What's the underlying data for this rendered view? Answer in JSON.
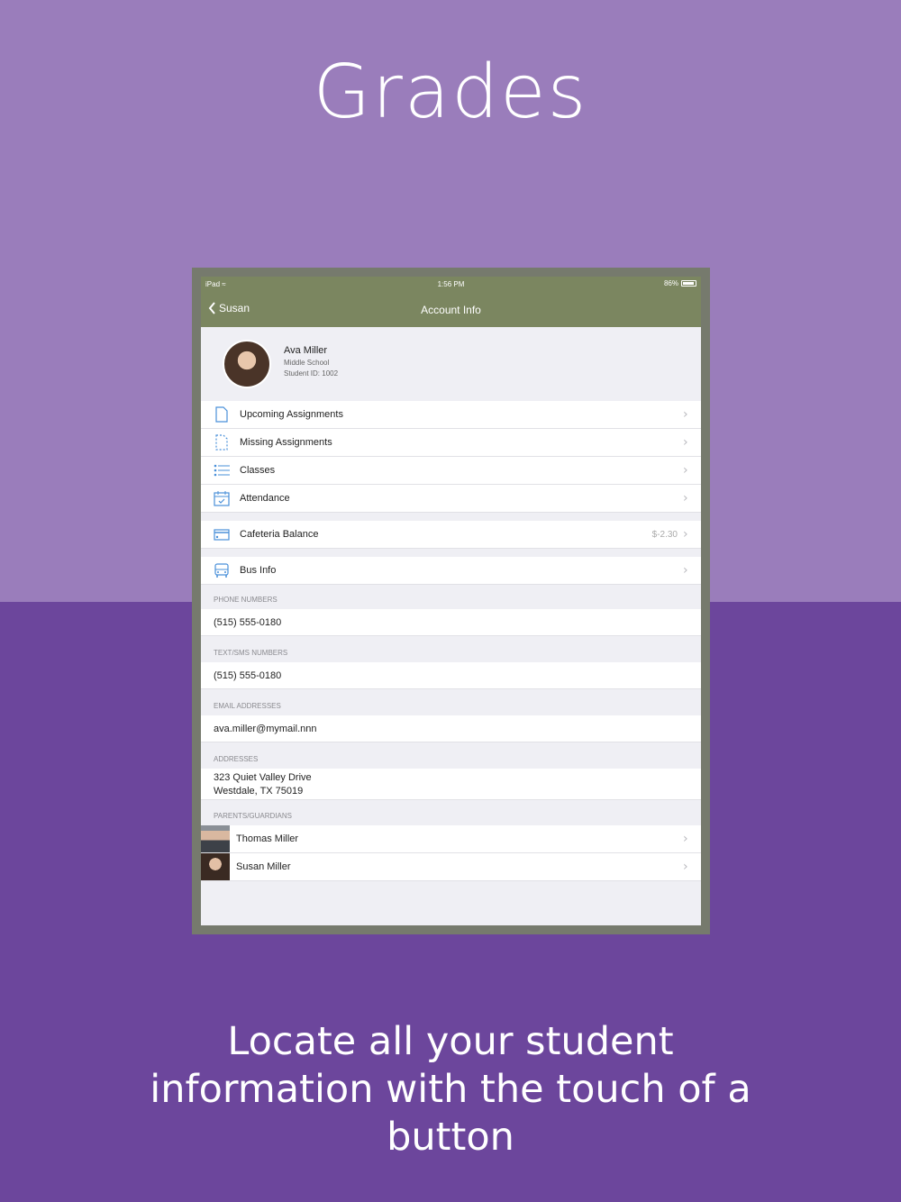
{
  "headline": "Grades",
  "tagline": "Locate all your student information with the touch of a button",
  "colors": {
    "bg_top": "#9a7dbb",
    "bg_bottom": "#6c469c",
    "navbar": "#7b8660",
    "icon_blue": "#4a90d9"
  },
  "statusbar": {
    "carrier": "iPad",
    "time": "1:56 PM",
    "battery": "86%"
  },
  "navbar": {
    "back_label": "Susan",
    "title": "Account Info"
  },
  "profile": {
    "name": "Ava Miller",
    "school": "Middle School",
    "student_id": "Student ID: 1002"
  },
  "menu": {
    "upcoming": "Upcoming Assignments",
    "missing": "Missing Assignments",
    "classes": "Classes",
    "attendance": "Attendance",
    "cafeteria": "Cafeteria Balance",
    "cafeteria_value": "$-2.30",
    "bus": "Bus Info"
  },
  "sections": {
    "phone_header": "PHONE NUMBERS",
    "phone": "(515) 555-0180",
    "sms_header": "TEXT/SMS NUMBERS",
    "sms": "(515) 555-0180",
    "email_header": "EMAIL ADDRESSES",
    "email": "ava.miller@mymail.nnn",
    "address_header": "ADDRESSES",
    "address_line1": "323 Quiet Valley Drive",
    "address_line2": "Westdale, TX 75019",
    "guardians_header": "PARENTS/GUARDIANS"
  },
  "guardians": [
    {
      "name": "Thomas Miller"
    },
    {
      "name": "Susan Miller"
    }
  ]
}
